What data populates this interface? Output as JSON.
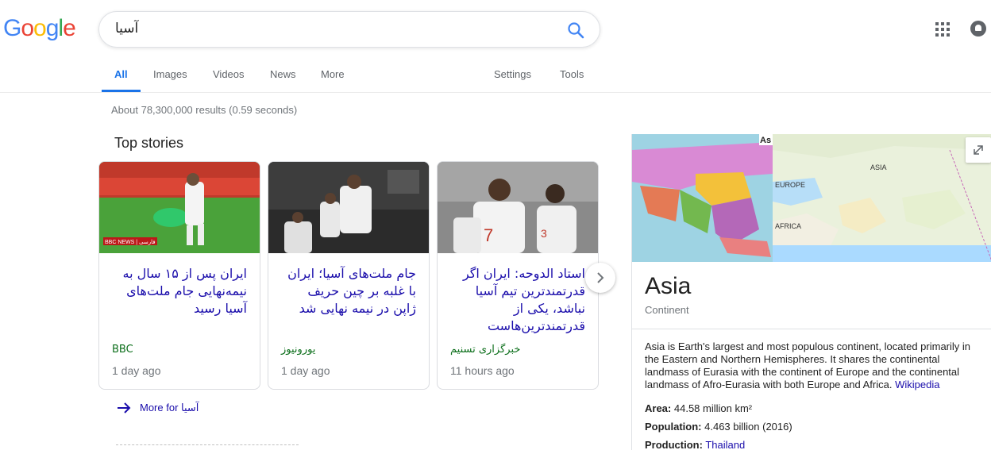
{
  "header": {
    "logo": [
      "G",
      "o",
      "o",
      "g",
      "l",
      "e"
    ],
    "logo_colors": [
      "#4285f4",
      "#ea4335",
      "#fbbc05",
      "#4285f4",
      "#34a853",
      "#ea4335"
    ],
    "search_value": "آسیا",
    "icons": [
      "search-icon",
      "apps-icon",
      "notifications-icon"
    ]
  },
  "tabs": {
    "all": "All",
    "images": "Images",
    "videos": "Videos",
    "news": "News",
    "more": "More",
    "settings": "Settings",
    "tools": "Tools"
  },
  "result_stats": "About 78,300,000 results (0.59 seconds)",
  "top_stories": {
    "title": "Top stories",
    "cards": [
      {
        "title": "ایران پس از ۱۵ سال به نیمه‌نهایی جام ملت‌های آسیا رسید",
        "source": "BBC",
        "time": "1 day ago",
        "image_badge": "BBC NEWS | فارسی"
      },
      {
        "title": "جام ملت‌های آسیا؛ ایران با غلبه بر چین حریف ژاپن در نیمه نهایی شد",
        "source": "یورونیوز",
        "time": "1 day ago"
      },
      {
        "title": "استاد الدوحه: ایران اگر قدرتمندترین تیم آسیا نباشد، یکی از قدرتمندترین‌هاست",
        "source": "خبرگزاری تسنیم",
        "time": "11 hours ago"
      }
    ],
    "more_label": "More for آسیا"
  },
  "knowledge_panel": {
    "title": "Asia",
    "subtitle": "Continent",
    "map_labels": {
      "asia": "ASIA",
      "europe": "EUROPE",
      "africa": "AFRICA",
      "corner": "As"
    },
    "description": "Asia is Earth's largest and most populous continent, located primarily in the Eastern and Northern Hemispheres. It shares the continental landmass of Eurasia with the continent of Europe and the continental landmass of Afro-Eurasia with both Europe and Africa.",
    "description_link": "Wikipedia",
    "facts": [
      {
        "label": "Area:",
        "value": "44.58 million km²"
      },
      {
        "label": "Population:",
        "value": "4.463 billion (2016)"
      },
      {
        "label": "Production:",
        "value": "Thailand"
      }
    ]
  }
}
